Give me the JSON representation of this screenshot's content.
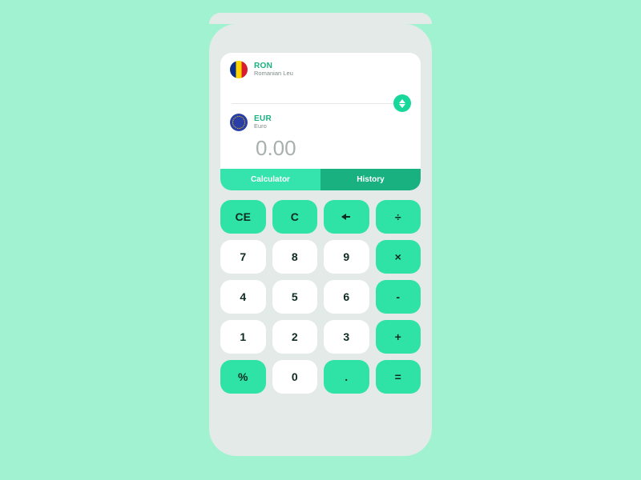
{
  "from": {
    "code": "RON",
    "name": "Romanian Leu"
  },
  "to": {
    "code": "EUR",
    "name": "Euro",
    "amount": "0.00"
  },
  "tabs": {
    "calculator": "Calculator",
    "history": "History"
  },
  "keys": {
    "ce": "CE",
    "c": "C",
    "div": "÷",
    "k7": "7",
    "k8": "8",
    "k9": "9",
    "mul": "×",
    "k4": "4",
    "k5": "5",
    "k6": "6",
    "sub": "-",
    "k1": "1",
    "k2": "2",
    "k3": "3",
    "add": "+",
    "pct": "%",
    "k0": "0",
    "dot": ".",
    "eq": "="
  }
}
